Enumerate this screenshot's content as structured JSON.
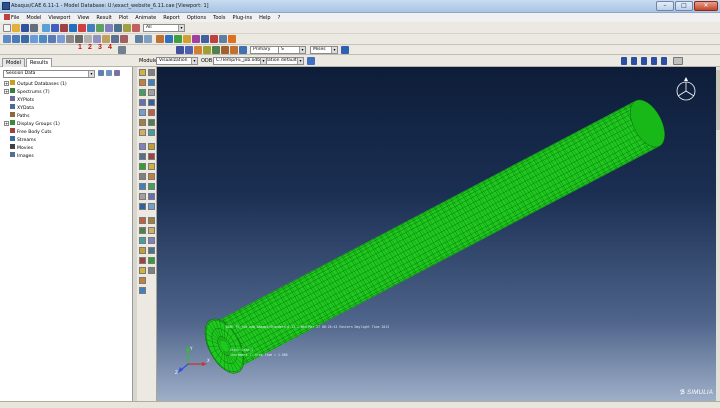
{
  "window": {
    "title": "Abaqus/CAE 6.11-1 - Model Database: U:\\exact_website_6.11.cae [Viewport: 1]",
    "buttons": [
      "–",
      "□",
      "✕"
    ]
  },
  "menu": [
    "File",
    "Model",
    "Viewport",
    "View",
    "Result",
    "Plot",
    "Animate",
    "Report",
    "Options",
    "Tools",
    "Plug-ins",
    "Help",
    "?"
  ],
  "toolbar": {
    "all_field": "All",
    "numbers": [
      "1",
      "2",
      "3",
      "4"
    ],
    "primary_select": "Primary",
    "s_select": "S",
    "mises_select": "Mises",
    "vis_defaults": "Visualization defaults"
  },
  "context": {
    "module_label": "Module:",
    "module_value": "Visualization",
    "odb_label": "ODB:",
    "odb_value": "C:/Temp/FE_job.odb"
  },
  "left_panel": {
    "tabs": [
      "Model",
      "Results"
    ],
    "active_tab": "Results",
    "session": "Session Data",
    "tree": [
      {
        "label": "Output Databases (1)",
        "expandable": true,
        "icon_color": "#c8a020"
      },
      {
        "label": "Spectrums (7)",
        "expandable": true,
        "icon_color": "#3a7a3a"
      },
      {
        "label": "XYPlots",
        "expandable": false,
        "icon_color": "#6a6a9a"
      },
      {
        "label": "XYData",
        "expandable": false,
        "icon_color": "#4a6a9a"
      },
      {
        "label": "Paths",
        "expandable": false,
        "icon_color": "#8a6a3a"
      },
      {
        "label": "Display Groups (1)",
        "expandable": true,
        "icon_color": "#3a8a3a"
      },
      {
        "label": "Free Body Cuts",
        "expandable": false,
        "icon_color": "#a04040"
      },
      {
        "label": "Streams",
        "expandable": false,
        "icon_color": "#3a6aa0"
      },
      {
        "label": "Movies",
        "expandable": false,
        "icon_color": "#404040"
      },
      {
        "label": "Images",
        "expandable": false,
        "icon_color": "#507090"
      }
    ]
  },
  "viewport": {
    "mesh_color": "#1ec81e",
    "mesh_line_color": "#0a5a0a",
    "info_line1": "ODB: FE_job.odb    Abaqus/Standard 6.11-1    Wed Mar 27 08:26:43 Eastern Daylight Time 2013",
    "info_line2": "Step: Step-1",
    "info_line3": "Increment   1: Step Time =    1.000",
    "triad": [
      "X",
      "Y",
      "Z"
    ],
    "brand": "SIMULIA",
    "brand_logo": "3DS"
  }
}
